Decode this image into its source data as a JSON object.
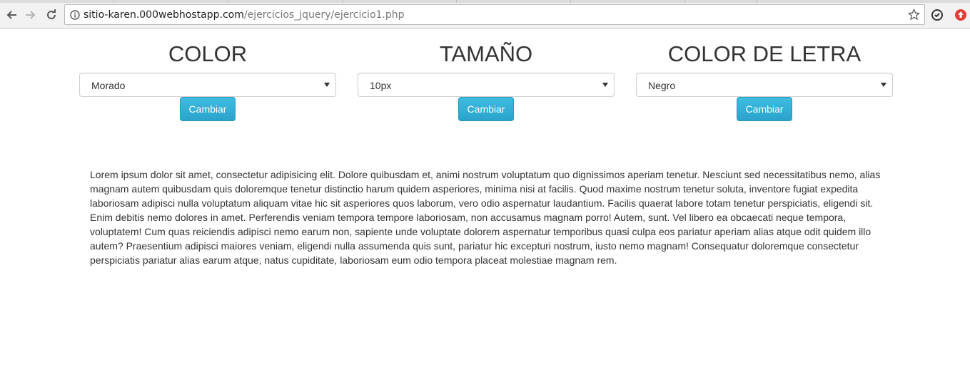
{
  "browser": {
    "url_host": "sitio-karen.000webhostapp.com",
    "url_path": "/ejercicios_jquery/ejercicio1.php"
  },
  "controls": [
    {
      "heading": "COLOR",
      "selected": "Morado",
      "button": "Cambiar"
    },
    {
      "heading": "TAMAÑO",
      "selected": "10px",
      "button": "Cambiar"
    },
    {
      "heading": "COLOR DE LETRA",
      "selected": "Negro",
      "button": "Cambiar"
    }
  ],
  "paragraph": "Lorem ipsum dolor sit amet, consectetur adipisicing elit. Dolore quibusdam et, animi nostrum voluptatum quo dignissimos aperiam tenetur. Nesciunt sed necessitatibus nemo, alias magnam autem quibusdam quis doloremque tenetur distinctio harum quidem asperiores, minima nisi at facilis. Quod maxime nostrum tenetur soluta, inventore fugiat expedita laboriosam adipisci nulla voluptatum aliquam vitae hic sit asperiores quos laborum, vero odio aspernatur laudantium. Facilis quaerat labore totam tenetur perspiciatis, eligendi sit. Enim debitis nemo dolores in amet. Perferendis veniam tempora tempore laboriosam, non accusamus magnam porro! Autem, sunt. Vel libero ea obcaecati neque tempora, voluptatem! Cum quas reiciendis adipisci nemo earum non, sapiente unde voluptate dolorem aspernatur temporibus quasi culpa eos pariatur aperiam alias atque odit quidem illo autem? Praesentium adipisci maiores veniam, eligendi nulla assumenda quis sunt, pariatur hic excepturi nostrum, iusto nemo magnam! Consequatur doloremque consectetur perspiciatis pariatur alias earum atque, natus cupiditate, laboriosam eum odio tempora placeat molestiae magnam rem.",
  "icons": {
    "back": "back-arrow-icon",
    "forward": "forward-arrow-icon",
    "reload": "reload-icon",
    "info": "info-icon",
    "bookmark": "star-icon",
    "extension1": "sync-extension-icon",
    "extension2": "upload-extension-icon"
  },
  "colors": {
    "button": "#31b0d5",
    "text": "#333333",
    "extension_red": "#e53935"
  }
}
